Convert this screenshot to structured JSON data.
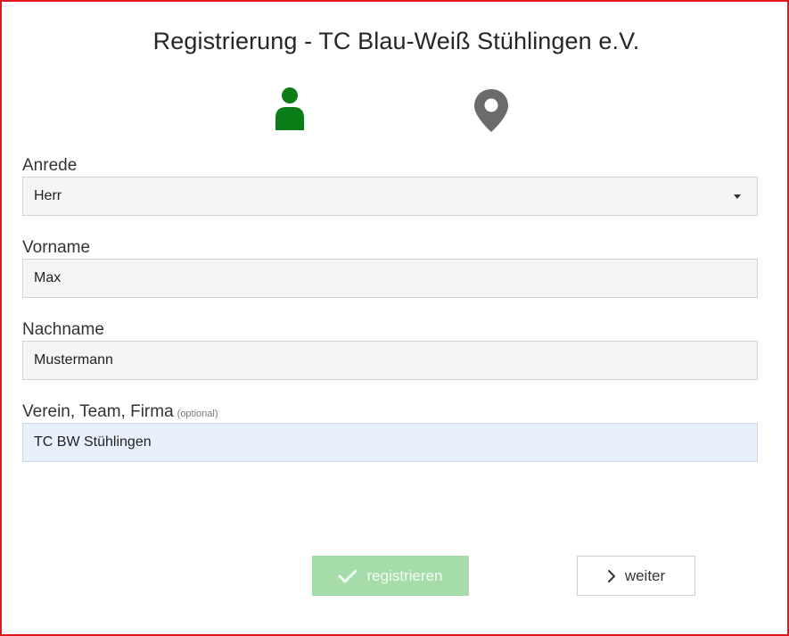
{
  "page": {
    "title": "Registrierung - TC Blau-Weiß Stühlingen e.V."
  },
  "steps": [
    {
      "icon": "person-icon",
      "color": "#0a7d16",
      "active": true
    },
    {
      "icon": "map-pin-icon",
      "color": "#6b6b6b",
      "active": false
    }
  ],
  "form": {
    "anrede": {
      "label": "Anrede",
      "value": "Herr"
    },
    "vorname": {
      "label": "Vorname",
      "value": "Max"
    },
    "nachname": {
      "label": "Nachname",
      "value": "Mustermann"
    },
    "verein": {
      "label": "Verein, Team, Firma",
      "optional_note": "(optional)",
      "value": "TC BW Stühlingen"
    }
  },
  "buttons": {
    "register": {
      "label": "registrieren",
      "icon": "checkmark-icon",
      "disabled": true
    },
    "next": {
      "label": "weiter",
      "icon": "chevron-right-icon"
    }
  },
  "colors": {
    "frame_border": "#e3161e",
    "accent_green": "#0a7d16",
    "disabled_button": "#a6dca9",
    "autofill_background": "#e8f0fe"
  }
}
